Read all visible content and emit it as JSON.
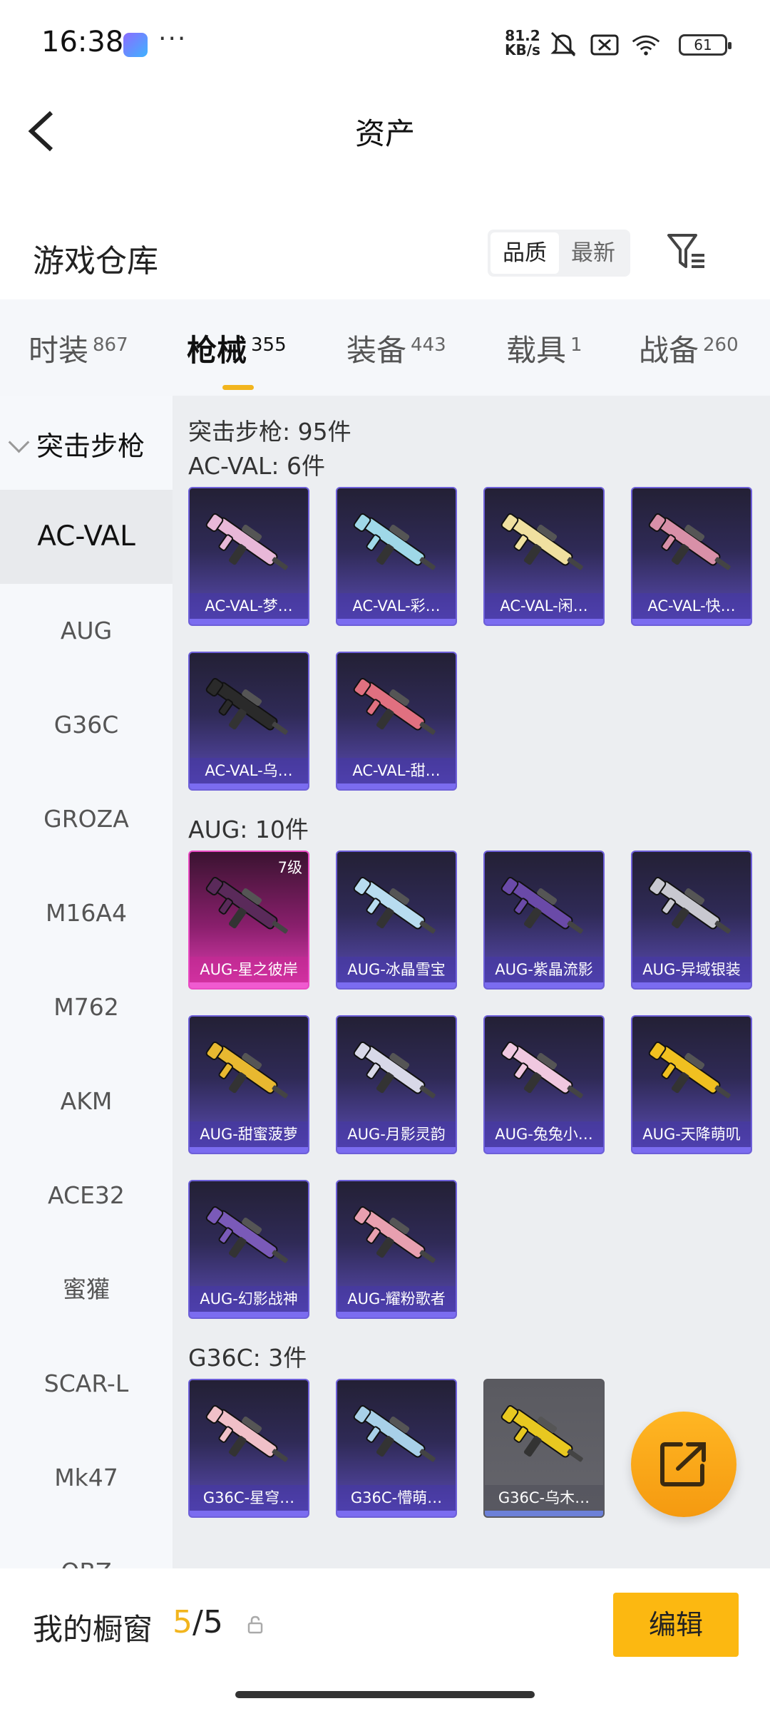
{
  "status_bar": {
    "time": "16:38",
    "more": "···",
    "net_speed_value": "81.2",
    "net_speed_unit": "KB/s",
    "battery": "61",
    "icons": [
      "app-notification-icon",
      "mute-icon",
      "sim-off-icon",
      "wifi-icon",
      "battery-icon"
    ]
  },
  "nav": {
    "title": "资产",
    "back_icon": "back-arrow-icon"
  },
  "section": {
    "title": "游戏仓库",
    "sort_options": [
      "品质",
      "最新"
    ],
    "sort_selected": "品质",
    "filter_icon": "filter-icon"
  },
  "tabs": [
    {
      "label": "时装",
      "count": "867"
    },
    {
      "label": "枪械",
      "count": "355",
      "active": true
    },
    {
      "label": "装备",
      "count": "443"
    },
    {
      "label": "载具",
      "count": "1"
    },
    {
      "label": "战备",
      "count": "260"
    }
  ],
  "sidebar": {
    "group": "突击步枪",
    "items": [
      "AC-VAL",
      "AUG",
      "G36C",
      "GROZA",
      "M16A4",
      "M762",
      "AKM",
      "ACE32",
      "蜜獾",
      "SCAR-L",
      "Mk47",
      "QBZ"
    ],
    "selected": "AC-VAL"
  },
  "content": {
    "total": "突击步枪: 95件",
    "groups": [
      {
        "title": "AC-VAL: 6件",
        "items": [
          {
            "name": "AC-VAL-梦…",
            "color": "#e8b8d8"
          },
          {
            "name": "AC-VAL-彩…",
            "color": "#9fd8e8"
          },
          {
            "name": "AC-VAL-闲…",
            "color": "#f0e0a0"
          },
          {
            "name": "AC-VAL-快…",
            "color": "#d890a8"
          },
          {
            "name": "AC-VAL-乌…",
            "color": "#2a2a2a"
          },
          {
            "name": "AC-VAL-甜…",
            "color": "#e07080"
          }
        ]
      },
      {
        "title": "AUG: 10件",
        "items": [
          {
            "name": "AUG-星之彼岸",
            "color": "#5a2a5a",
            "rarity": "pink",
            "level": "7级"
          },
          {
            "name": "AUG-冰晶雪宝",
            "color": "#b8dcf0"
          },
          {
            "name": "AUG-紫晶流影",
            "color": "#6a4aa8"
          },
          {
            "name": "AUG-异域银装",
            "color": "#c8c8d0"
          },
          {
            "name": "AUG-甜蜜菠萝",
            "color": "#e8b830"
          },
          {
            "name": "AUG-月影灵韵",
            "color": "#d8d8e8"
          },
          {
            "name": "AUG-兔兔小…",
            "color": "#f0c8e0"
          },
          {
            "name": "AUG-天降萌叽",
            "color": "#f0c020"
          },
          {
            "name": "AUG-幻影战神",
            "color": "#7a5ab8"
          },
          {
            "name": "AUG-耀粉歌者",
            "color": "#e8a0b0"
          }
        ]
      },
      {
        "title": "G36C: 3件",
        "items": [
          {
            "name": "G36C-星穹…",
            "color": "#f0c0c8"
          },
          {
            "name": "G36C-懵萌…",
            "color": "#a8d0e8"
          },
          {
            "name": "G36C-乌木…",
            "color": "#e8c820",
            "rarity": "gray"
          }
        ]
      }
    ]
  },
  "fab": {
    "icon": "share-export-icon"
  },
  "showcase": {
    "label": "我的橱窗",
    "current": "5",
    "total": "/5",
    "lock_icon": "lock-icon",
    "edit_button": "编辑"
  }
}
